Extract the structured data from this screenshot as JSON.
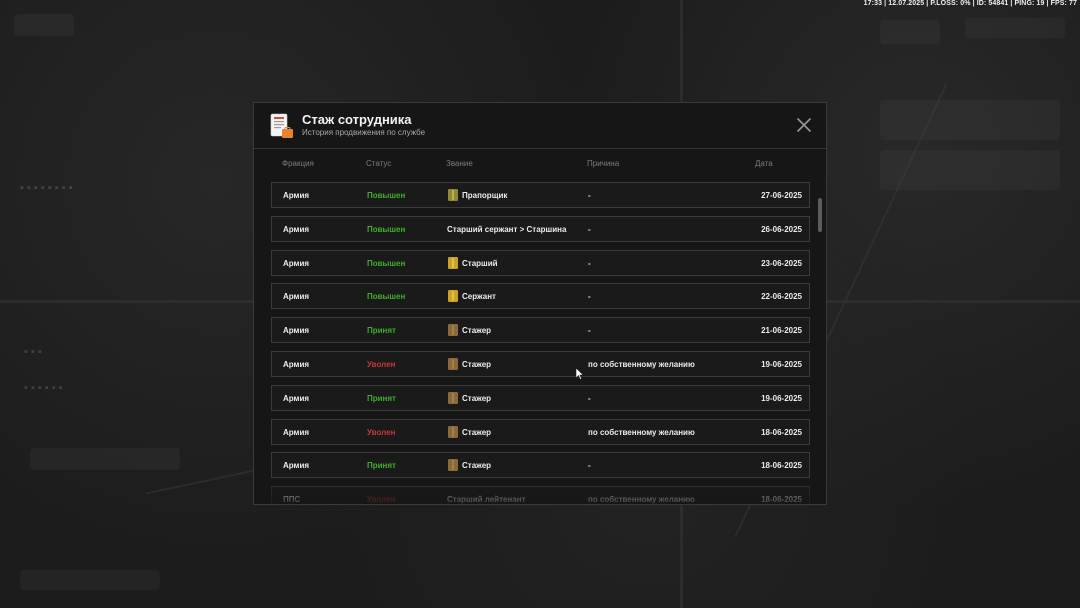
{
  "status_bar": {
    "text": "17:33 | 12.07.2025 | P.LOSS: 0% | ID: 54841 | PING: 19 | FPS: 77"
  },
  "modal": {
    "title": "Стаж сотрудника",
    "subtitle": "История продвижения по службе",
    "icon": "document-icon",
    "close_icon": "close-icon"
  },
  "columns": {
    "faction": "Фракция",
    "status": "Статус",
    "rank": "Звание",
    "reason": "Причина",
    "date": "Дата"
  },
  "colors": {
    "status_green": "#3fae2b",
    "status_red": "#c23a3a"
  },
  "rows": [
    {
      "faction": "Армия",
      "status": "Повышен",
      "status_type": "promoted",
      "rank": "Прапорщик",
      "rank_icon": "ensign-insignia-icon",
      "reason": "-",
      "date": "27-06-2025"
    },
    {
      "faction": "Армия",
      "status": "Повышен",
      "status_type": "promoted",
      "rank": "Старший сержант > Старшина",
      "rank_icon": "",
      "reason": "-",
      "date": "26-06-2025"
    },
    {
      "faction": "Армия",
      "status": "Повышен",
      "status_type": "promoted",
      "rank": "Старший",
      "rank_icon": "senior-insignia-icon",
      "reason": "-",
      "date": "23-06-2025"
    },
    {
      "faction": "Армия",
      "status": "Повышен",
      "status_type": "promoted",
      "rank": "Сержант",
      "rank_icon": "sergeant-insignia-icon",
      "reason": "-",
      "date": "22-06-2025"
    },
    {
      "faction": "Армия",
      "status": "Принят",
      "status_type": "accepted",
      "rank": "Стажер",
      "rank_icon": "trainee-insignia-icon",
      "reason": "-",
      "date": "21-06-2025"
    },
    {
      "faction": "Армия",
      "status": "Уволен",
      "status_type": "fired",
      "rank": "Стажер",
      "rank_icon": "trainee-insignia-icon",
      "reason": "по собственному желанию",
      "date": "19-06-2025"
    },
    {
      "faction": "Армия",
      "status": "Принят",
      "status_type": "accepted",
      "rank": "Стажер",
      "rank_icon": "trainee-insignia-icon",
      "reason": "-",
      "date": "19-06-2025"
    },
    {
      "faction": "Армия",
      "status": "Уволен",
      "status_type": "fired",
      "rank": "Стажер",
      "rank_icon": "trainee-insignia-icon",
      "reason": "по собственному желанию",
      "date": "18-06-2025"
    },
    {
      "faction": "Армия",
      "status": "Принят",
      "status_type": "accepted",
      "rank": "Стажер",
      "rank_icon": "trainee-insignia-icon",
      "reason": "-",
      "date": "18-06-2025"
    },
    {
      "faction": "ППС",
      "status": "Уволен",
      "status_type": "fired",
      "rank": "Старший лейтенант",
      "rank_icon": "",
      "reason": "по собственному желанию",
      "date": "18-06-2025"
    }
  ]
}
